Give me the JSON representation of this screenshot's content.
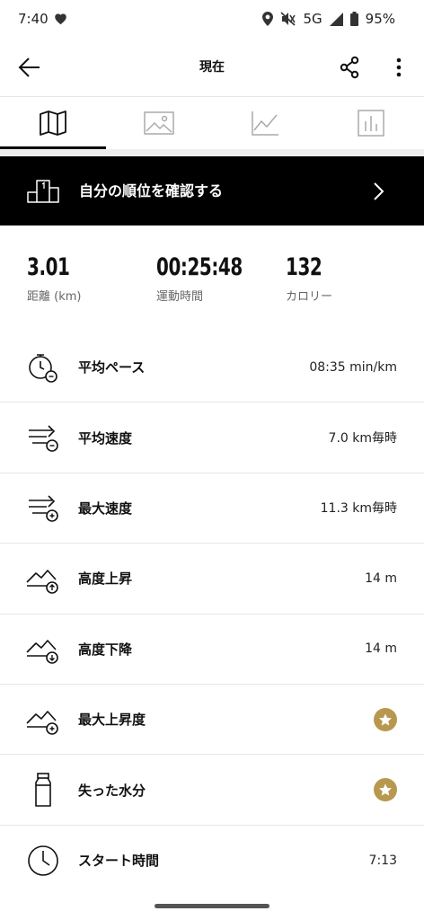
{
  "status_bar": {
    "time": "7:40",
    "network": "5G",
    "battery": "95%",
    "icons": [
      "heart-icon",
      "location-icon",
      "mute-icon",
      "signal-icon",
      "battery-icon"
    ]
  },
  "header": {
    "title": "現在",
    "icons": [
      "back-arrow-icon",
      "share-icon",
      "more-vert-icon"
    ]
  },
  "tabs": [
    {
      "icon": "map-icon",
      "active": true
    },
    {
      "icon": "image-icon",
      "active": false
    },
    {
      "icon": "line-chart-icon",
      "active": false
    },
    {
      "icon": "bar-chart-icon",
      "active": false
    }
  ],
  "rank_banner": {
    "label": "自分の順位を確認する",
    "icon": "podium-icon"
  },
  "summary": [
    {
      "value": "3.01",
      "label": "距離 (km)"
    },
    {
      "value": "00:25:48",
      "label": "運動時間"
    },
    {
      "value": "132",
      "label": "カロリー"
    }
  ],
  "metrics": [
    {
      "name": "平均ペース",
      "value": "08:35 min/km",
      "icon": "stopwatch-pace-icon"
    },
    {
      "name": "平均速度",
      "value": "7.0 km毎時",
      "icon": "speed-avg-icon"
    },
    {
      "name": "最大速度",
      "value": "11.3 km毎時",
      "icon": "speed-max-icon"
    },
    {
      "name": "高度上昇",
      "value": "14 m",
      "icon": "elevation-up-icon"
    },
    {
      "name": "高度下降",
      "value": "14 m",
      "icon": "elevation-down-icon"
    },
    {
      "name": "最大上昇度",
      "value": "",
      "icon": "elevation-max-icon",
      "premium": true
    },
    {
      "name": "失った水分",
      "value": "",
      "icon": "water-bottle-icon",
      "premium": true
    },
    {
      "name": "スタート時間",
      "value": "7:13",
      "icon": "clock-icon"
    }
  ],
  "colors": {
    "banner_bg": "#000000",
    "premium_gold": "#b8974f",
    "divider": "#e6e6e6"
  }
}
